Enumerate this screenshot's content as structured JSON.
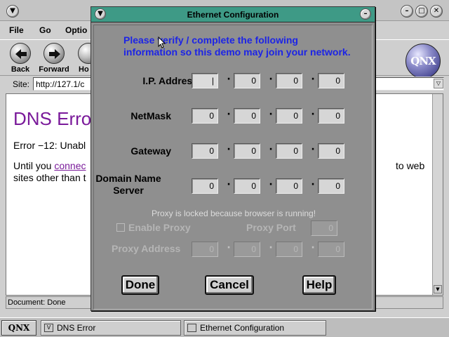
{
  "browser": {
    "menu": [
      "File",
      "Go",
      "Optio"
    ],
    "toolbar": [
      "Back",
      "Forward",
      "Ho"
    ],
    "site_label": "Site:",
    "site_url": "http://127.1/c",
    "logo_text": "QNX",
    "content": {
      "title": "DNS Erro",
      "line1": "Error −12: Unabl",
      "line2_a": "Until you ",
      "line2_link": "connec",
      "line2_tail": "to web",
      "line3": "sites other than t"
    },
    "status": "Document: Done"
  },
  "dialog": {
    "title": "Ethernet Configuration",
    "prompt_line1": "Please verify / complete the following",
    "prompt_line2": "information so this demo may join your network.",
    "rows": [
      {
        "label": "I.P. Address",
        "octets": [
          "|",
          "0",
          "0",
          "0"
        ]
      },
      {
        "label": "NetMask",
        "octets": [
          "0",
          "0",
          "0",
          "0"
        ]
      },
      {
        "label": "Gateway",
        "octets": [
          "0",
          "0",
          "0",
          "0"
        ]
      },
      {
        "label_line1": "Domain Name",
        "label_line2": "Server",
        "octets": [
          "0",
          "0",
          "0",
          "0"
        ]
      }
    ],
    "proxy_note": "Proxy is locked because browser is running!",
    "enable_proxy": "Enable Proxy",
    "proxy_port_label": "Proxy Port",
    "proxy_port_value": "0",
    "proxy_address_label": "Proxy Address",
    "proxy_address": [
      "0",
      "0",
      "0",
      "0"
    ],
    "buttons": {
      "done": "Done",
      "cancel": "Cancel",
      "help": "Help"
    }
  },
  "taskbar": {
    "start": "QNX",
    "tasks": [
      "DNS Error",
      "Ethernet Configuration"
    ]
  }
}
